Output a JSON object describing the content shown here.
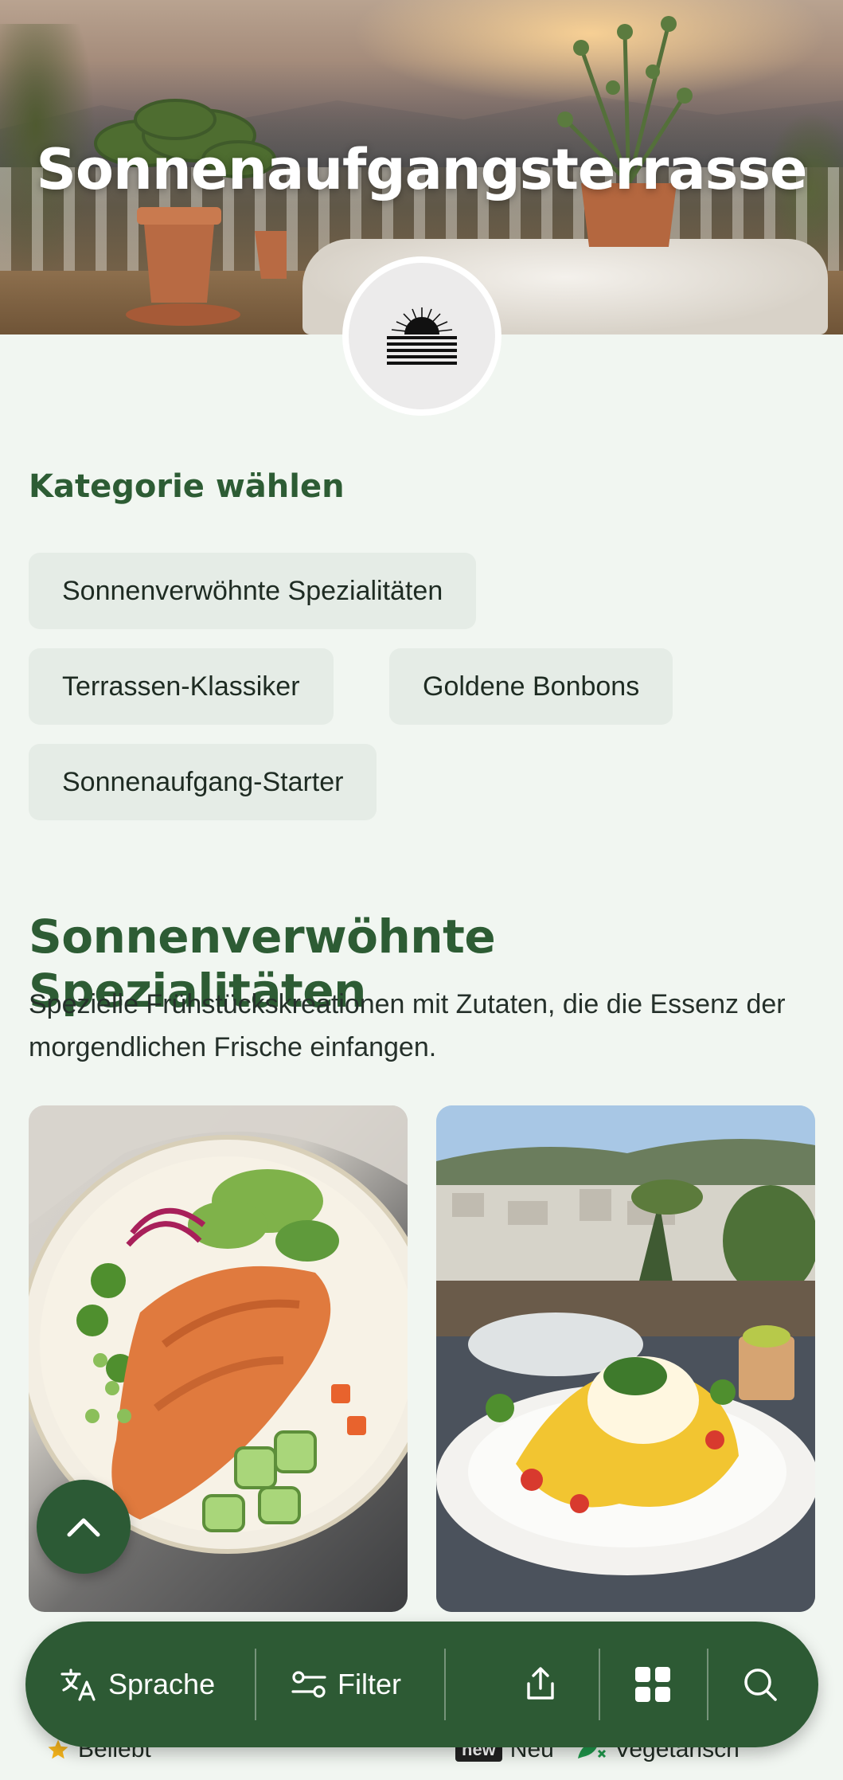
{
  "hero": {
    "title": "Sonnenaufgangsterrasse"
  },
  "logo": {
    "icon": "sunrise-icon"
  },
  "categories": {
    "label": "Kategorie wählen",
    "chips": [
      "Sonnenverwöhnte Spezialitäten",
      "Terrassen-Klassiker",
      "Goldene Bonbons",
      "Sonnenaufgang-Starter"
    ]
  },
  "section": {
    "title": "Sonnenverwöhnte Spezialitäten",
    "description": "Spezielle Frühstückskreationen mit Zutaten, die die Essenz der morgendlichen Frische einfangen."
  },
  "cards": [
    {
      "image": "salmon-bowl-photo"
    },
    {
      "image": "eggs-benedict-terrace-photo"
    }
  ],
  "legend": {
    "popular": "Beliebt",
    "new_badge": "new",
    "new": "Neu",
    "vegetarian": "Vegetarisch"
  },
  "bottom_bar": {
    "language": "Sprache",
    "filter": "Filter"
  },
  "colors": {
    "primary_green": "#2d5a34",
    "background": "#f1f6f1",
    "chip_bg": "#e5ece6",
    "star": "#f2b21c",
    "veg_icon": "#1f9a4c"
  }
}
